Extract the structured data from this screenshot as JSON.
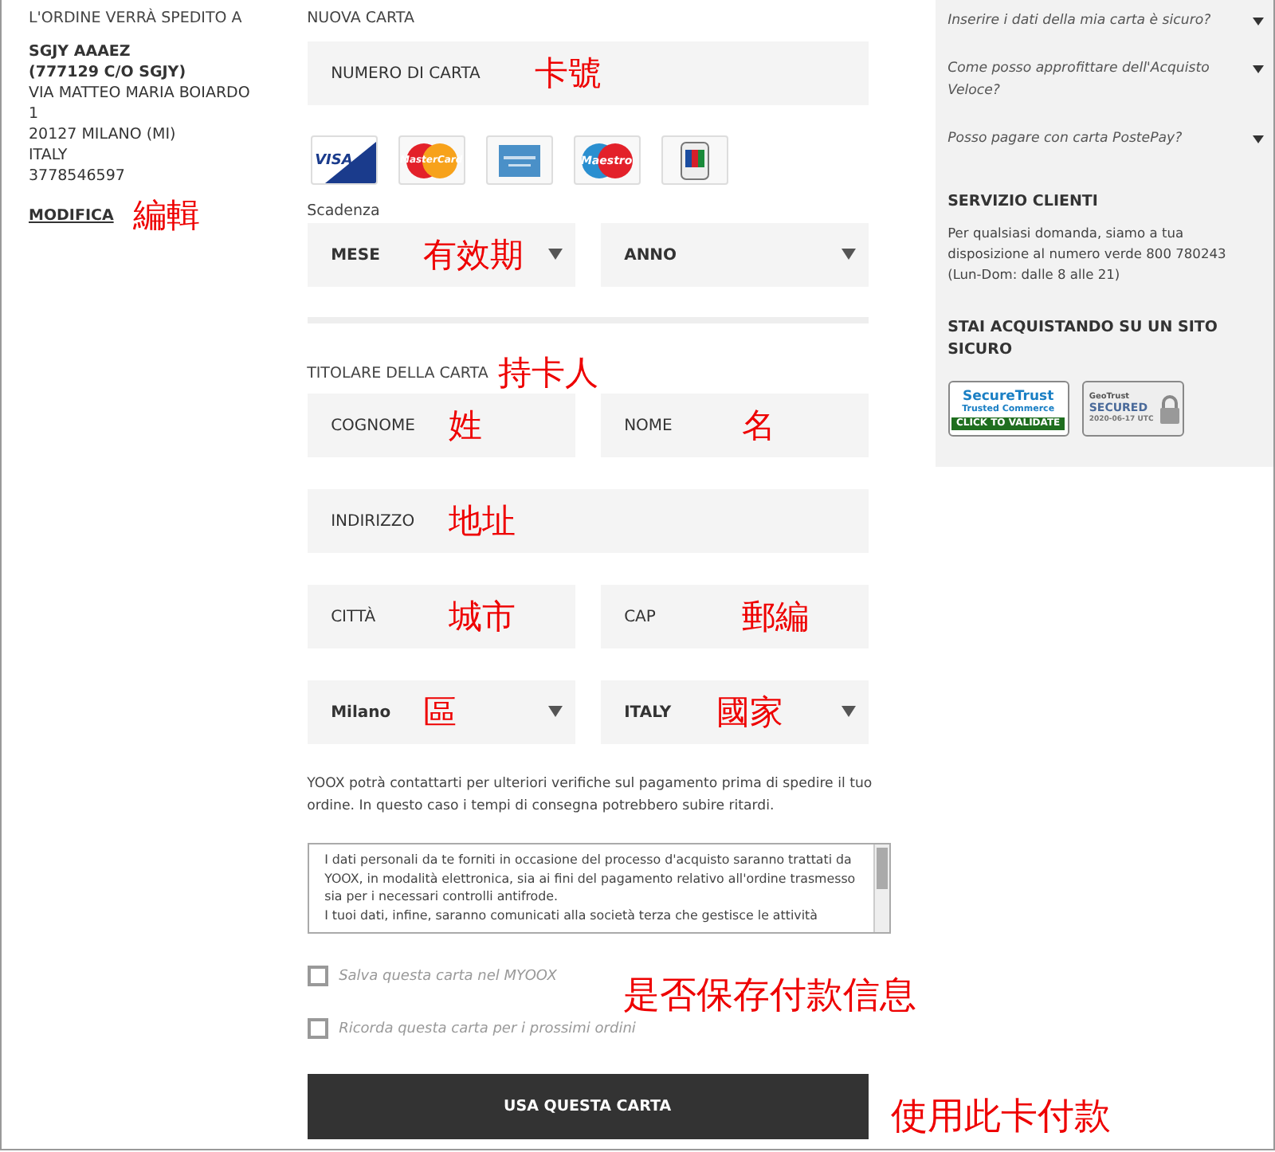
{
  "shipping": {
    "heading": "L'ORDINE VERRÀ SPEDITO A",
    "lines": [
      "SGJY AAAEZ",
      "(777129 C/O SGJY)",
      "VIA MATTEO MARIA BOIARDO",
      "1",
      "20127 MILANO (MI)",
      "ITALY",
      "3778546597"
    ],
    "edit_link": "MODIFICA",
    "annotation": "編輯"
  },
  "card": {
    "heading": "NUOVA CARTA",
    "number_field": {
      "placeholder": "NUMERO DI CARTA",
      "annotation": "卡號"
    },
    "logos": [
      {
        "kind": "visa",
        "text": "VISA"
      },
      {
        "kind": "mastercard",
        "text": "MasterCard"
      },
      {
        "kind": "amex"
      },
      {
        "kind": "maestro",
        "text": "Maestro"
      },
      {
        "kind": "jcb"
      }
    ],
    "expiry_label": "Scadenza",
    "expiry": [
      {
        "kind": "select",
        "value": "MESE",
        "annotation": "有效期"
      },
      {
        "kind": "select",
        "value": "ANNO"
      }
    ],
    "holder_label": "TITOLARE DELLA CARTA",
    "holder_annotation": "持卡人",
    "rows": [
      [
        {
          "kind": "input",
          "placeholder": "COGNOME",
          "annotation": "姓"
        },
        {
          "kind": "input",
          "placeholder": "NOME",
          "annotation": "名"
        }
      ],
      [
        {
          "kind": "input",
          "placeholder": "INDIRIZZO",
          "annotation": "地址"
        }
      ],
      [
        {
          "kind": "input",
          "placeholder": "CITTÀ",
          "annotation": "城市"
        },
        {
          "kind": "input",
          "placeholder": "CAP",
          "annotation": "郵編"
        }
      ],
      [
        {
          "kind": "select",
          "value": "Milano",
          "annotation": "區"
        },
        {
          "kind": "select",
          "value": "ITALY",
          "annotation": "國家"
        }
      ]
    ],
    "notice": "YOOX potrà contattarti per ulteriori verifiche sul pagamento prima di spedire il tuo ordine. In questo caso i tempi di consegna potrebbero subire ritardi.",
    "privacy_text": [
      "I dati personali da te forniti in occasione del processo d'acquisto saranno trattati da YOOX, in modalità elettronica, sia ai fini del pagamento relativo all'ordine trasmesso sia per i necessari controlli antifrode.",
      "I tuoi dati, infine, saranno comunicati alla società terza che gestisce le attività"
    ],
    "checkboxes": [
      {
        "label": "Salva questa carta nel MYOOX",
        "checked": false
      },
      {
        "label": "Ricorda questa carta per i prossimi ordini",
        "checked": false
      }
    ],
    "checkbox_annotation": "是否保存付款信息",
    "submit": "USA QUESTA CARTA",
    "submit_annotation": "使用此卡付款"
  },
  "sidebar": {
    "faq": [
      {
        "question": "Inserire i dati della mia carta è sicuro?",
        "expanded": false
      },
      {
        "question": "Come posso approfittare dell'Acquisto Veloce?",
        "expanded": false
      },
      {
        "question": "Posso pagare con carta PostePay?",
        "expanded": false
      }
    ],
    "service_title": "SERVIZIO CLIENTI",
    "service_text": "Per qualsiasi domanda, siamo a tua disposizione al numero verde 800 780243 (Lun-Dom: dalle 8 alle 21)",
    "secure_title": "STAI ACQUISTANDO SU UN SITO SICURO",
    "badges": [
      {
        "kind": "securetrust",
        "lines": [
          "SecureTrust",
          "Trusted Commerce",
          "CLICK TO VALIDATE"
        ]
      },
      {
        "kind": "geotrust",
        "lines": [
          "GeoTrust",
          "SECURED",
          "2020-06-17 UTC"
        ]
      }
    ]
  }
}
